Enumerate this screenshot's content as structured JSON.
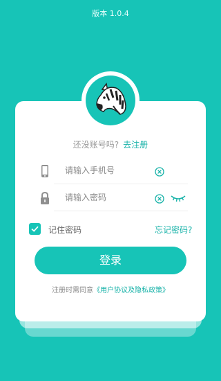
{
  "header": {
    "version": "版本 1.0.4"
  },
  "register": {
    "prompt": "还没账号吗?",
    "link": "去注册"
  },
  "phone_field": {
    "placeholder": "请输入手机号",
    "value": ""
  },
  "password_field": {
    "placeholder": "请输入密码",
    "value": ""
  },
  "remember": {
    "label": "记住密码",
    "checked": true
  },
  "forgot": {
    "label": "忘记密码?"
  },
  "login_button": {
    "label": "登录"
  },
  "agreement": {
    "prefix": "注册时需同意",
    "link": "《用户协议及隐私政策》"
  },
  "colors": {
    "accent": "#17c4b7",
    "link": "#17b2a8",
    "background": "#17c4b7"
  },
  "icons": {
    "avatar": "zebra-logo-icon",
    "phone": "phone-icon",
    "password": "lock-icon",
    "clear": "clear-circle-icon",
    "visibility": "eye-closed-icon",
    "check": "check-icon"
  }
}
